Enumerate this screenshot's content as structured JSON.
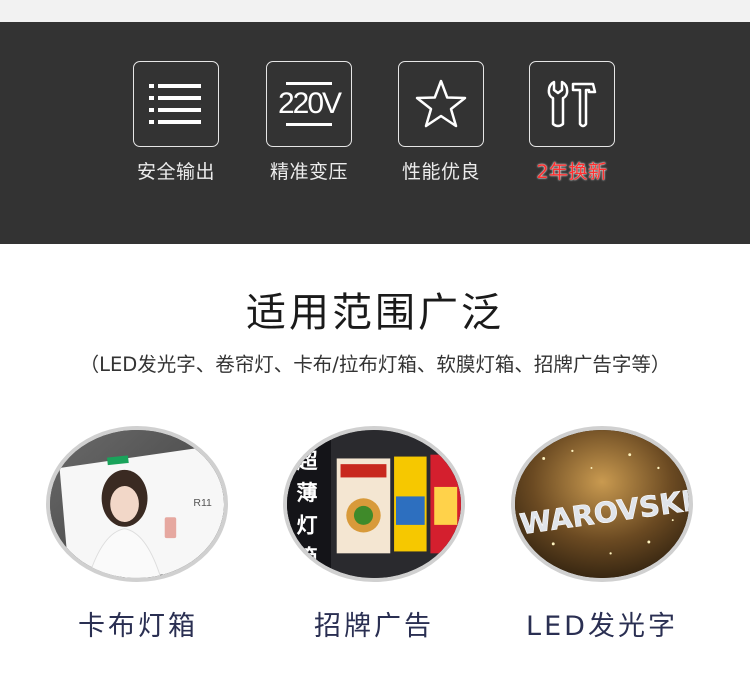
{
  "features": [
    {
      "label": "安全输出",
      "icon": "list-icon"
    },
    {
      "label": "精准变压",
      "icon": "voltage-icon",
      "icon_text": "220V"
    },
    {
      "label": "性能优良",
      "icon": "star-icon"
    },
    {
      "label": "2年换新",
      "icon": "tools-icon",
      "label_color": "#ff3030"
    }
  ],
  "heading": "适用范围广泛",
  "subheading": "（LED发光字、卷帘灯、卡布/拉布灯箱、软膜灯箱、招牌广告字等）",
  "applications": [
    {
      "caption": "卡布灯箱",
      "photo_text": "R11"
    },
    {
      "caption": "招牌广告",
      "photo_text": "超薄灯箱"
    },
    {
      "caption": "LED发光字",
      "photo_text": "WAROVSKI"
    }
  ],
  "colors": {
    "band": "#333333",
    "caption": "#2a2f52",
    "accent_red": "#ff3030"
  }
}
